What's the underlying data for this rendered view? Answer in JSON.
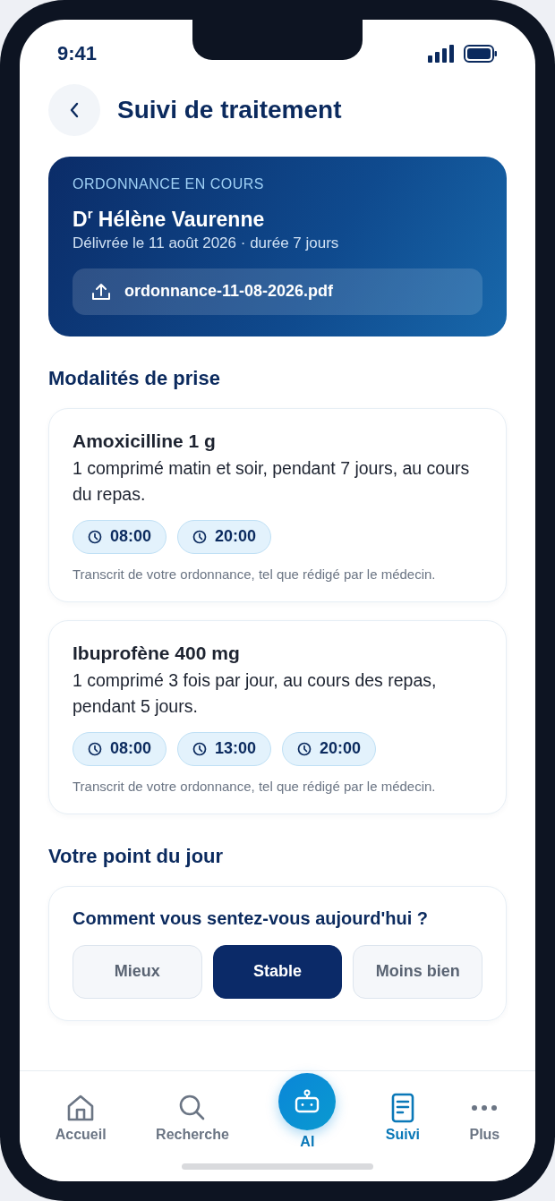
{
  "status_bar": {
    "time": "9:41"
  },
  "header": {
    "title": "Suivi de traitement"
  },
  "prescription": {
    "label": "ORDONNANCE EN COURS",
    "doctor": "D$^{r}$ Hélène Vaurenne",
    "details": "Délivrée le 11 août 2026 · durée 7 jours",
    "file": "ordonnance-11-08-2026.pdf"
  },
  "dosage_section": {
    "title": "Modalités de prise"
  },
  "medications": [
    {
      "name": "Amoxicilline 1 g",
      "instructions": "1 comprimé matin et soir, pendant 7 jours, au cours du repas.",
      "times": [
        "08:00",
        "20:00"
      ],
      "note": "Transcrit de votre ordonnance, tel que rédigé par le médecin."
    },
    {
      "name": "Ibuprofène 400 mg",
      "instructions": "1 comprimé 3 fois par jour, au cours des repas, pendant 5 jours.",
      "times": [
        "08:00",
        "13:00",
        "20:00"
      ],
      "note": "Transcrit de votre ordonnance, tel que rédigé par le médecin."
    }
  ],
  "daily_check": {
    "title": "Votre point du jour",
    "question": "Comment vous sentez-vous aujourd'hui ?",
    "options": [
      {
        "label": "Mieux",
        "selected": false
      },
      {
        "label": "Stable",
        "selected": true
      },
      {
        "label": "Moins bien",
        "selected": false
      }
    ]
  },
  "nav": [
    {
      "kind": "home",
      "label": "Accueil",
      "selected": false
    },
    {
      "kind": "search",
      "label": "Recherche",
      "selected": false
    },
    {
      "kind": "ai",
      "label": "AI",
      "selected": false
    },
    {
      "kind": "document",
      "label": "Suivi",
      "selected": true
    },
    {
      "kind": "more",
      "label": "Plus",
      "selected": false
    }
  ]
}
